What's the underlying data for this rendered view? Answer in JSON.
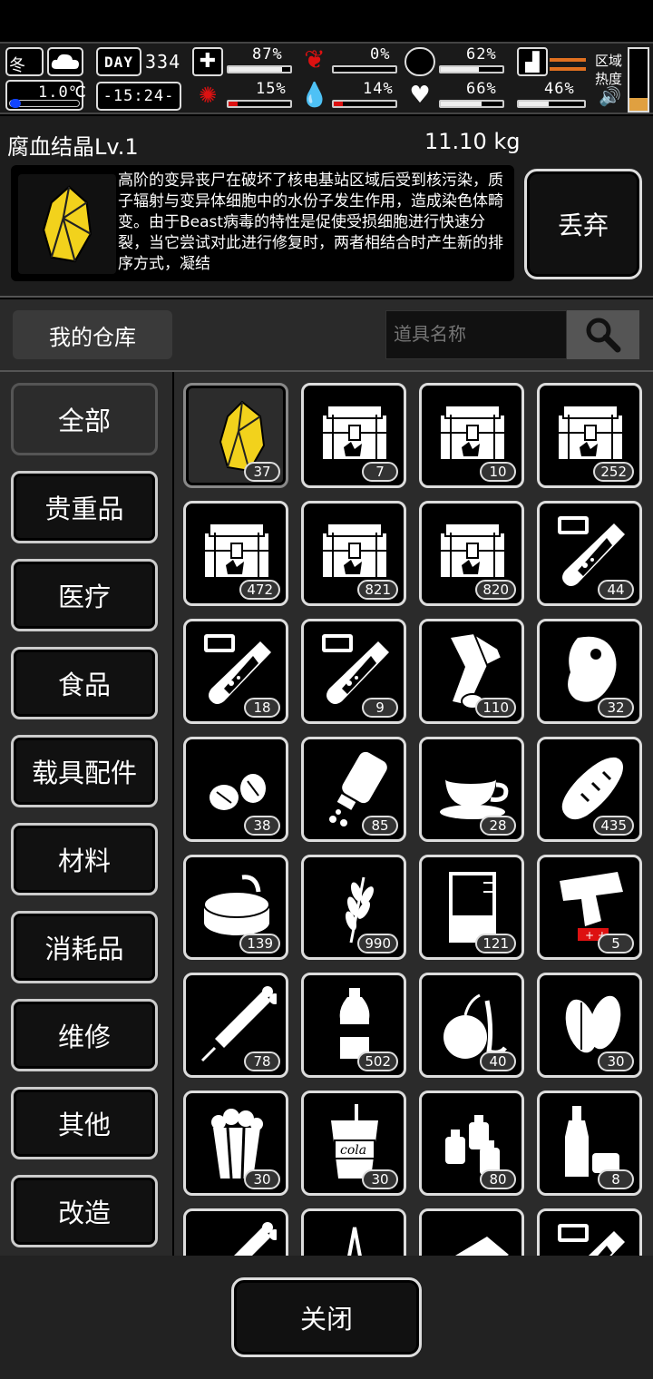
{
  "status": {
    "season": "冬",
    "day_label": "DAY",
    "day_number": "334",
    "temperature": "1.0℃",
    "time": "-15:24-",
    "health_pct": "87%",
    "hunger_pct": "0%",
    "thirst_pct": "62%",
    "stamina_pct": "46%",
    "mental_pct": "15%",
    "blood_pct": "14%",
    "mood_pct": "66%",
    "zone_label": "区域",
    "heat_label": "热度",
    "bars": {
      "health": 0.87,
      "hunger": 0.0,
      "thirst": 0.62,
      "mental": 0.15,
      "blood": 0.14,
      "mood": 0.66,
      "stamina": 0.46
    }
  },
  "item": {
    "name": "腐血结晶Lv.1",
    "weight": "11.10 kg",
    "description": "高阶的变异丧尸在破坏了核电基站区域后受到核污染，质子辐射与变异体细胞中的水份子发生作用，造成染色体畸变。由于Beast病毒的特性是促使受损细胞进行快速分裂，当它尝试对此进行修复时，两者相结合时产生新的排序方式，凝结",
    "drop_label": "丢弃"
  },
  "warehouse": {
    "label": "我的仓库",
    "search_placeholder": "道具名称"
  },
  "categories": [
    "全部",
    "贵重品",
    "医疗",
    "食品",
    "载具配件",
    "材料",
    "消耗品",
    "维修",
    "其他",
    "改造"
  ],
  "items": [
    {
      "icon": "crystal-icon",
      "count": "37"
    },
    {
      "icon": "crate-icon",
      "count": "7"
    },
    {
      "icon": "crate-icon",
      "count": "10"
    },
    {
      "icon": "crate-icon",
      "count": "252"
    },
    {
      "icon": "crate-icon",
      "count": "472"
    },
    {
      "icon": "crate-icon",
      "count": "821"
    },
    {
      "icon": "crate-icon",
      "count": "820"
    },
    {
      "icon": "syringe-tube-icon",
      "count": "44"
    },
    {
      "icon": "syringe-tube-icon",
      "count": "18"
    },
    {
      "icon": "syringe-tube-icon",
      "count": "9"
    },
    {
      "icon": "bandage-roll-icon",
      "count": "110"
    },
    {
      "icon": "meat-icon",
      "count": "32"
    },
    {
      "icon": "nuts-icon",
      "count": "38"
    },
    {
      "icon": "pill-bottle-icon",
      "count": "85"
    },
    {
      "icon": "coffee-cup-icon",
      "count": "28"
    },
    {
      "icon": "bread-icon",
      "count": "435"
    },
    {
      "icon": "canned-food-icon",
      "count": "139"
    },
    {
      "icon": "wheat-icon",
      "count": "990"
    },
    {
      "icon": "beaker-icon",
      "count": "121"
    },
    {
      "icon": "flare-gun-icon",
      "count": "5"
    },
    {
      "icon": "syringe-icon",
      "count": "78"
    },
    {
      "icon": "water-bottle-icon",
      "count": "502"
    },
    {
      "icon": "fruit-icon",
      "count": "40"
    },
    {
      "icon": "seeds-icon",
      "count": "30"
    },
    {
      "icon": "popcorn-icon",
      "count": "30"
    },
    {
      "icon": "cola-cup-icon",
      "count": "30"
    },
    {
      "icon": "spray-bottles-icon",
      "count": "80"
    },
    {
      "icon": "liquor-bottle-icon",
      "count": "8"
    },
    {
      "icon": "syringe-icon",
      "count": ""
    },
    {
      "icon": "tool-icon",
      "count": ""
    },
    {
      "icon": "box-icon",
      "count": ""
    },
    {
      "icon": "syringe-tube-icon",
      "count": ""
    }
  ],
  "close_label": "关闭",
  "colors": {
    "accent_red": "#dd1111",
    "crystal_yellow": "#f2d21c"
  }
}
